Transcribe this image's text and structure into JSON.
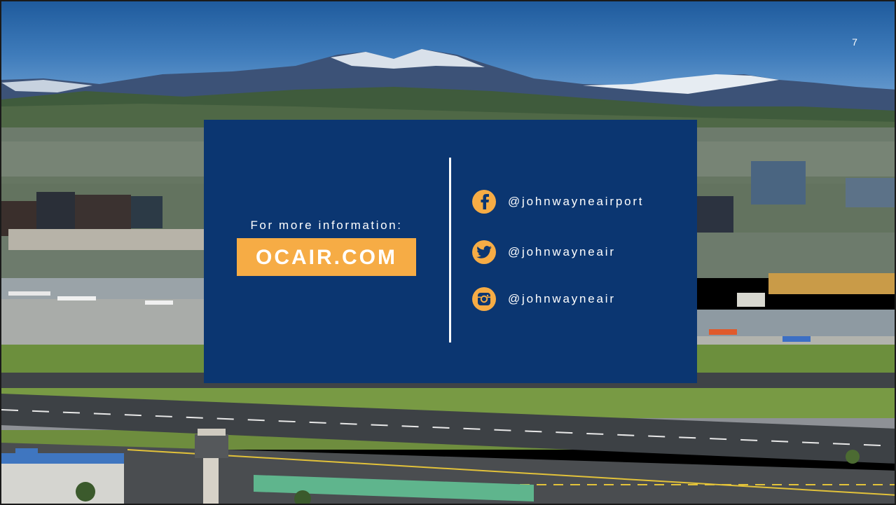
{
  "slide": {
    "page_number": "7",
    "info_label": "For more information:",
    "website": "OCAIR.COM",
    "social": [
      {
        "network": "facebook",
        "icon": "facebook-icon",
        "handle": "@johnwayneairport"
      },
      {
        "network": "twitter",
        "icon": "twitter-icon",
        "handle": "@johnwayneair"
      },
      {
        "network": "instagram",
        "icon": "instagram-icon",
        "handle": "@johnwayneair"
      }
    ]
  },
  "colors": {
    "panel": "#0b3671",
    "accent": "#f6ac45",
    "text": "#ffffff"
  }
}
